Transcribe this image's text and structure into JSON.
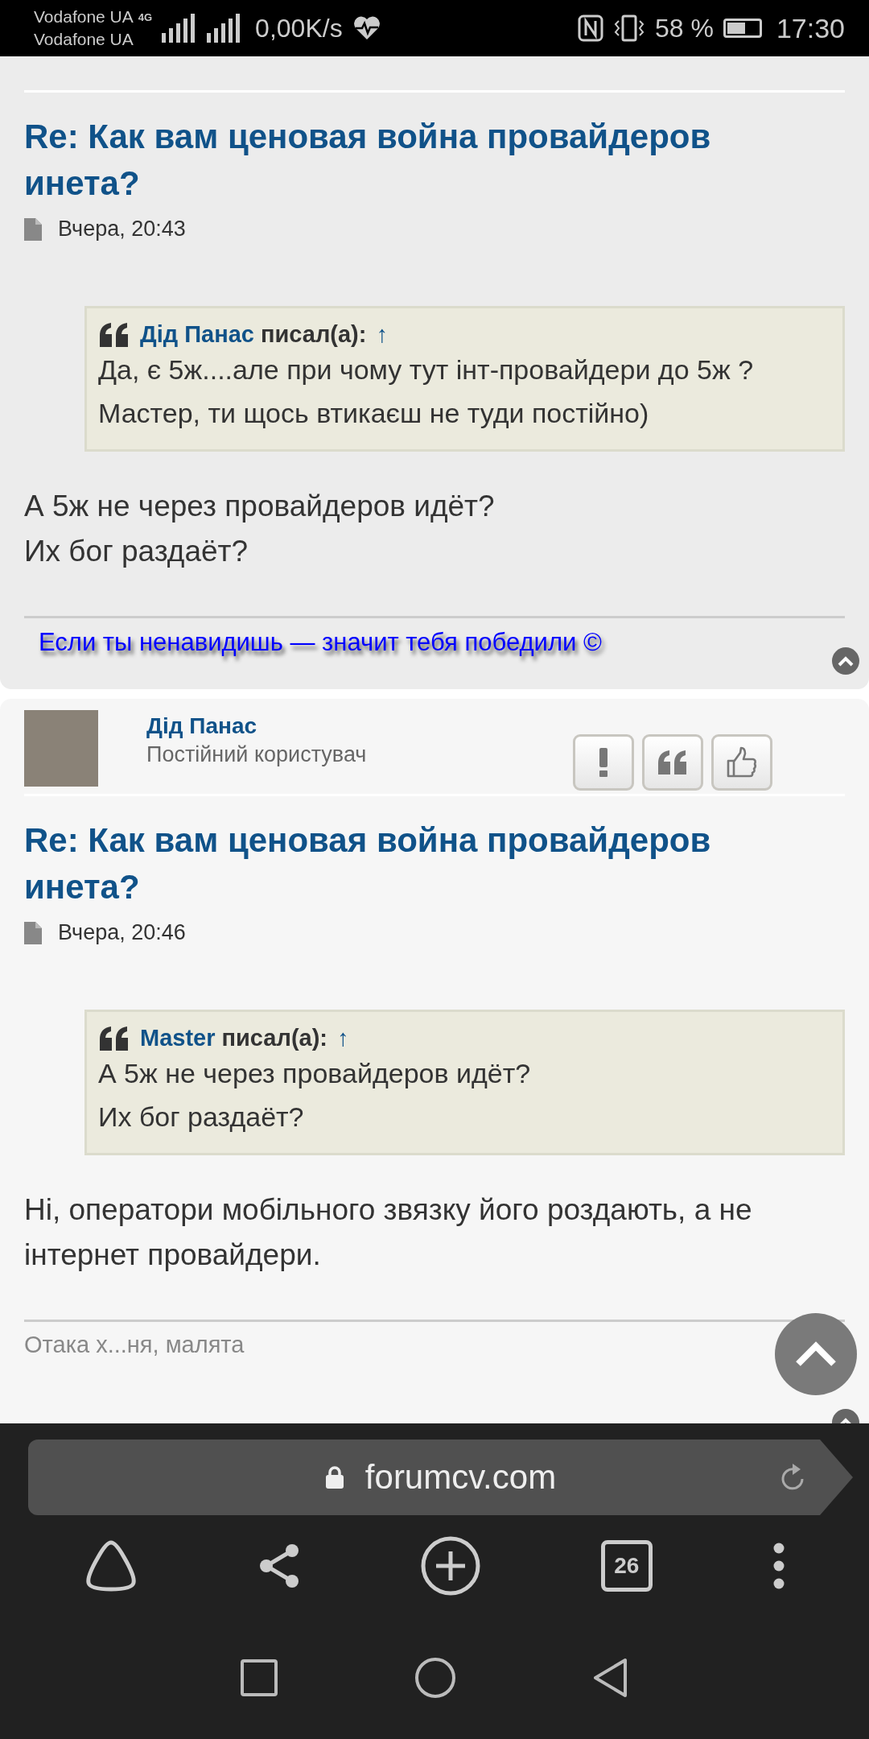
{
  "status_bar": {
    "carriers": [
      "Vodafone UA",
      "Vodafone UA"
    ],
    "network_type": "4G",
    "speed": "0,00K/s",
    "battery": "58 %",
    "time": "17:30"
  },
  "posts": [
    {
      "title": "Re: Как вам ценовая война провайдеров инета?",
      "date": "Вчера, 20:43",
      "quote": {
        "author": "Дід Панас",
        "said": "писал(а):",
        "arrow": "↑",
        "lines": [
          "Да, є 5ж....але при чому тут інт-провайдери до 5ж ?",
          "Мастер, ти щось втикаєш не туди постійно)"
        ]
      },
      "body": [
        "А 5ж не через провайдеров идёт?",
        "Их бог раздаёт?"
      ],
      "signature": {
        "kind": "link",
        "text": "Если ты ненавидишь — значит тебя победили ©"
      }
    },
    {
      "author": "Дід Панас",
      "role": "Постійний користувач",
      "title": "Re: Как вам ценовая война провайдеров инета?",
      "date": "Вчера, 20:46",
      "quote": {
        "author": "Master",
        "said": "писал(а):",
        "arrow": "↑",
        "lines": [
          "А 5ж не через провайдеров идёт?",
          "Их бог раздаёт?"
        ]
      },
      "body": [
        "Ні, оператори мобільного звязку його роздають, а не інтернет провайдери."
      ],
      "signature": {
        "kind": "plain",
        "text": "Отака х...ня, малята"
      }
    }
  ],
  "browser": {
    "url": "forumcv.com",
    "tab_count": "26"
  }
}
